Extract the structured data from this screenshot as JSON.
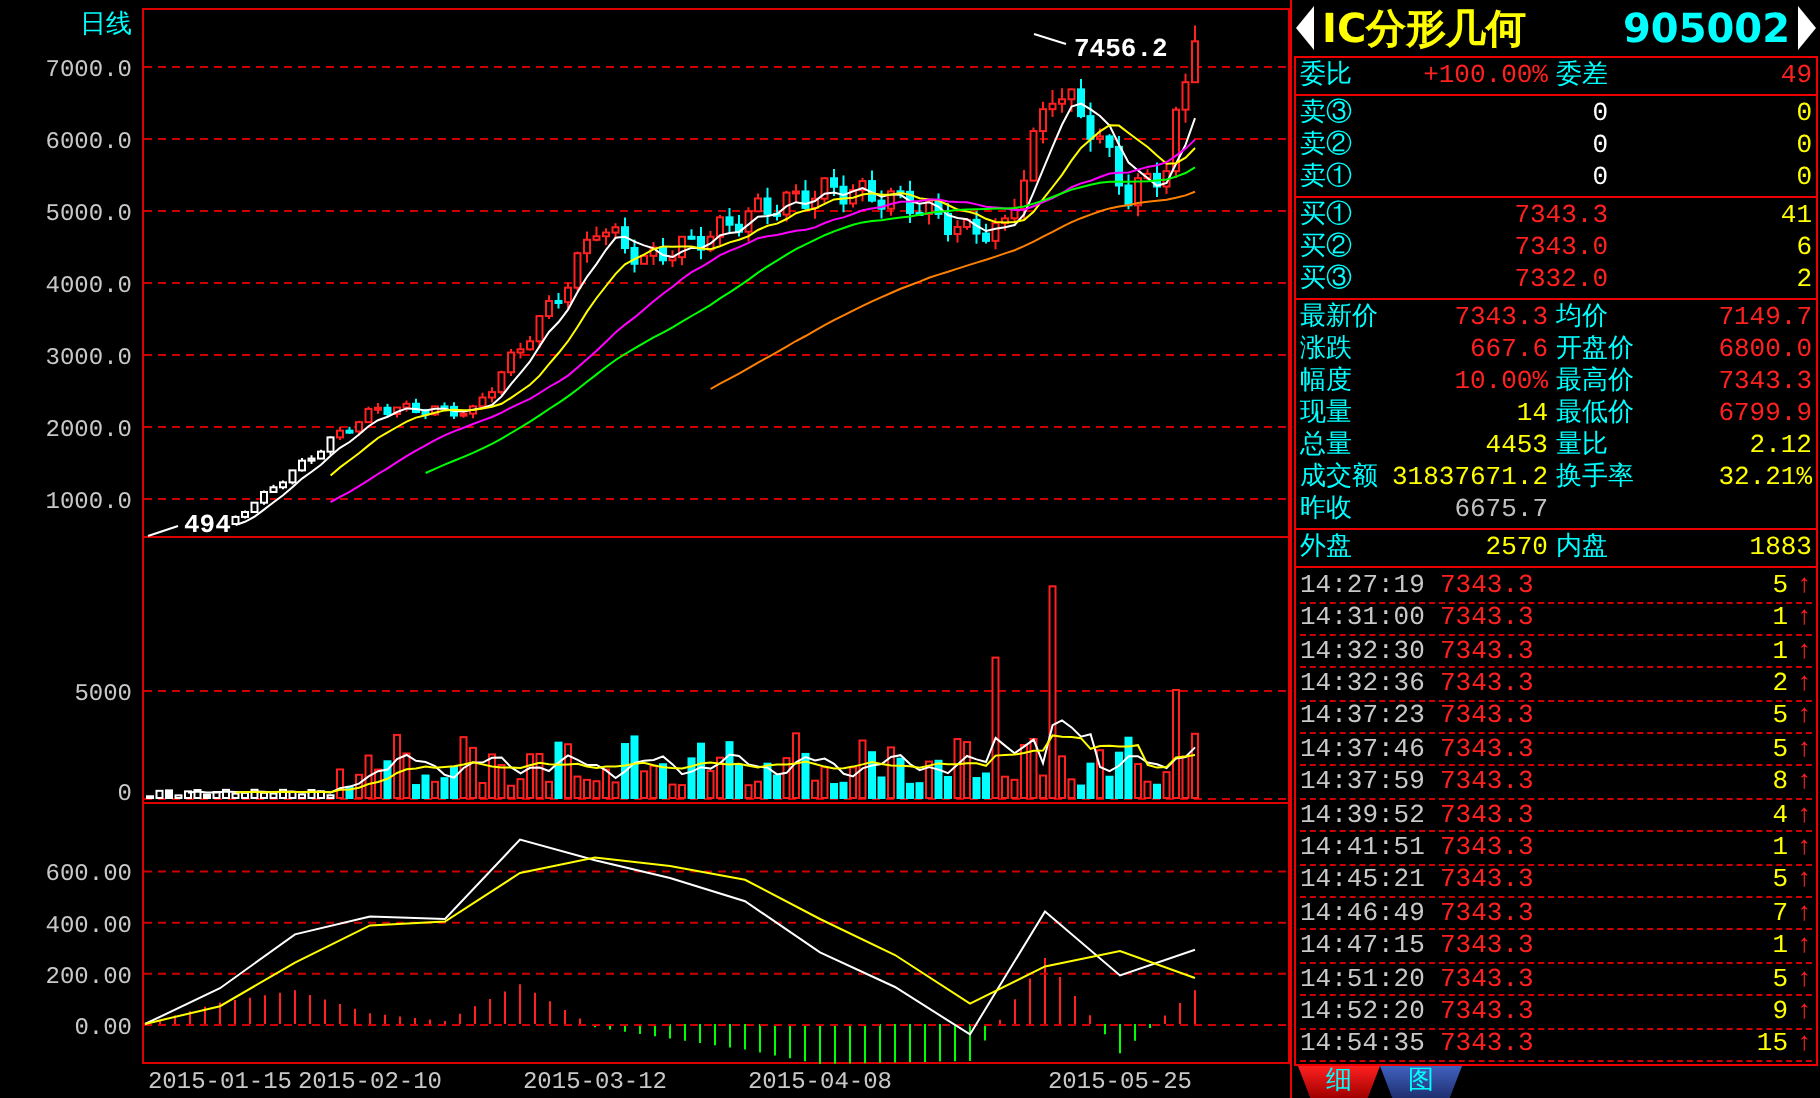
{
  "chart": {
    "period": "日线",
    "price_axis": [
      "7000.0",
      "6000.0",
      "5000.0",
      "4000.0",
      "3000.0",
      "2000.0",
      "1000.0"
    ],
    "high_label": "7456.2",
    "low_label": "494",
    "volume_axis": [
      "5000",
      "0"
    ],
    "macd": {
      "chart_data": {
        "type": "line",
        "grid": true,
        "ylim": [
          -148,
          867
        ],
        "categories": [
          null,
          "2015-01-15",
          null,
          "2015-02-10",
          null,
          null,
          "2015-03-12",
          null,
          null,
          "2015-04-08",
          null,
          null,
          null,
          "2015-05-25",
          null
        ],
        "yticks": [
          {
            "value": 600,
            "label": "600.00"
          },
          {
            "value": 400,
            "label": "400.00"
          },
          {
            "value": 200,
            "label": "200.00"
          },
          {
            "value": 0,
            "label": "0.00"
          }
        ],
        "series": [
          {
            "color": "#ffffff",
            "values": [
              0,
              140,
              350,
              420,
              410,
              720,
              640,
              570,
              480,
              280,
              145,
              -40,
              440,
              190,
              290
            ]
          },
          {
            "color": "#ffff00",
            "values": [
              0,
              70,
              240,
              385,
              400,
              590,
              650,
              617,
              563,
              410,
              270,
              80,
              225,
              285,
              180
            ]
          }
        ]
      }
    }
  },
  "quote": {
    "name": "IC分形几何",
    "code": "905002",
    "ratio": [
      {
        "label": "委比",
        "value": "+100.00%",
        "color": "#ff2020"
      },
      {
        "label": "委差",
        "value": "49",
        "color": "#ff2020"
      }
    ],
    "asks": [
      {
        "label": "卖③",
        "price": "0",
        "volume": "0",
        "color": "#ffffff"
      },
      {
        "label": "卖②",
        "price": "0",
        "volume": "0",
        "color": "#ffffff"
      },
      {
        "label": "卖①",
        "price": "0",
        "volume": "0",
        "color": "#ffffff"
      }
    ],
    "bids": [
      {
        "label": "买①",
        "price": "7343.3",
        "volume": "41",
        "color": "#ff2020"
      },
      {
        "label": "买②",
        "price": "7343.0",
        "volume": "6",
        "color": "#ff2020"
      },
      {
        "label": "买③",
        "price": "7332.0",
        "volume": "2",
        "color": "#ff2020"
      }
    ],
    "stats": [
      {
        "label": "最新价",
        "value": "7343.3",
        "color": "#ff2020"
      },
      {
        "label": "均价",
        "value": "7149.7",
        "color": "#ff2020"
      },
      {
        "label": "涨跌",
        "value": "667.6",
        "color": "#ff2020"
      },
      {
        "label": "开盘价",
        "value": "6800.0",
        "color": "#ff2020"
      },
      {
        "label": "幅度",
        "value": "10.00%",
        "color": "#ff2020"
      },
      {
        "label": "最高价",
        "value": "7343.3",
        "color": "#ff2020"
      },
      {
        "label": "现量",
        "value": "14",
        "color": "#ffff00"
      },
      {
        "label": "最低价",
        "value": "6799.9",
        "color": "#ff2020"
      },
      {
        "label": "总量",
        "value": "4453",
        "color": "#ffff00"
      },
      {
        "label": "量比",
        "value": "2.12",
        "color": "#ffff00"
      },
      {
        "label": "成交额",
        "value": "31837671.2",
        "color": "#ffff00"
      },
      {
        "label": "换手率",
        "value": "32.21%",
        "color": "#ffff00"
      },
      {
        "label": "昨收",
        "value": "6675.7",
        "color": "#c0c0c0"
      }
    ],
    "outer_inner": [
      {
        "label": "外盘",
        "value": "2570"
      },
      {
        "label": "内盘",
        "value": "1883"
      }
    ],
    "ticks": [
      {
        "time": "14:27:19",
        "price": "7343.3",
        "volume": "5",
        "arrow": "↑"
      },
      {
        "time": "14:31:00",
        "price": "7343.3",
        "volume": "1",
        "arrow": "↑"
      },
      {
        "time": "14:32:30",
        "price": "7343.3",
        "volume": "1",
        "arrow": "↑"
      },
      {
        "time": "14:32:36",
        "price": "7343.3",
        "volume": "2",
        "arrow": "↑"
      },
      {
        "time": "14:37:23",
        "price": "7343.3",
        "volume": "5",
        "arrow": "↑"
      },
      {
        "time": "14:37:46",
        "price": "7343.3",
        "volume": "5",
        "arrow": "↑"
      },
      {
        "time": "14:37:59",
        "price": "7343.3",
        "volume": "8",
        "arrow": "↑"
      },
      {
        "time": "14:39:52",
        "price": "7343.3",
        "volume": "4",
        "arrow": "↑"
      },
      {
        "time": "14:41:51",
        "price": "7343.3",
        "volume": "1",
        "arrow": "↑"
      },
      {
        "time": "14:45:21",
        "price": "7343.3",
        "volume": "5",
        "arrow": "↑"
      },
      {
        "time": "14:46:49",
        "price": "7343.3",
        "volume": "7",
        "arrow": "↑"
      },
      {
        "time": "14:47:15",
        "price": "7343.3",
        "volume": "1",
        "arrow": "↑"
      },
      {
        "time": "14:51:20",
        "price": "7343.3",
        "volume": "5",
        "arrow": "↑"
      },
      {
        "time": "14:52:20",
        "price": "7343.3",
        "volume": "9",
        "arrow": "↑"
      },
      {
        "time": "14:54:35",
        "price": "7343.3",
        "volume": "15",
        "arrow": "↑"
      }
    ],
    "tabs": [
      {
        "label": "细",
        "selected": true
      },
      {
        "label": "图",
        "selected": false
      }
    ]
  }
}
